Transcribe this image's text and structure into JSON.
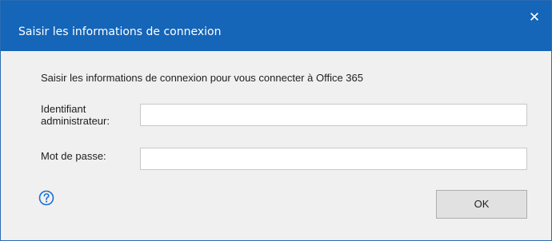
{
  "dialog": {
    "title": "Saisir les informations de connexion",
    "close_symbol": "✕"
  },
  "content": {
    "intro": "Saisir les informations de connexion pour vous connecter à Office 365",
    "admin_label": "Identifiant administrateur:",
    "admin_value": "",
    "password_label": "Mot de passe:",
    "password_value": ""
  },
  "footer": {
    "help_icon": "question-circle-icon",
    "ok_label": "OK"
  },
  "colors": {
    "titlebar": "#1565b8",
    "help_icon": "#1a6fd0",
    "background": "#f0f0f0"
  }
}
